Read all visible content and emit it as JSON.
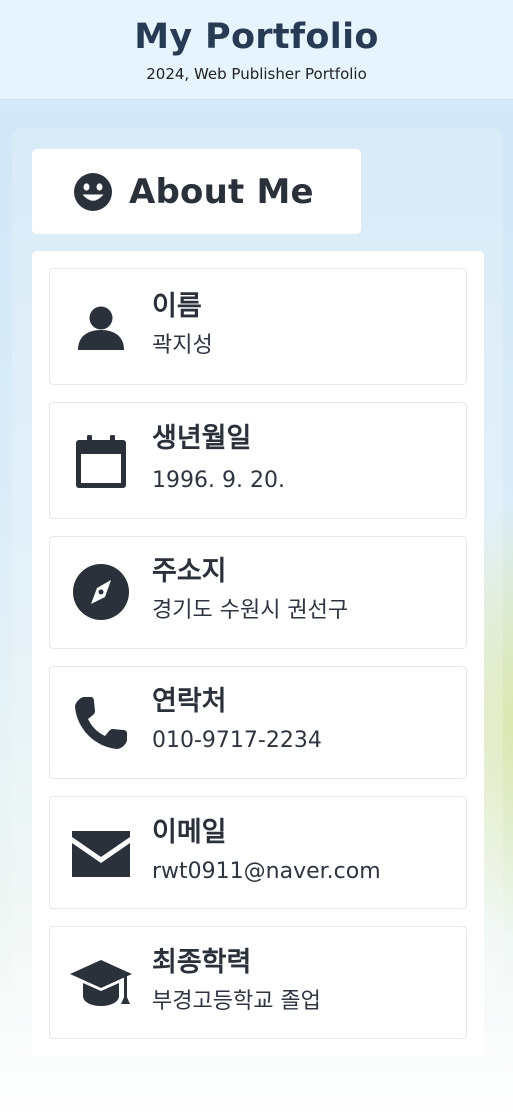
{
  "header": {
    "title": "My Portfolio",
    "subtitle": "2024, Web Publisher Portfolio"
  },
  "section": {
    "title": "About Me",
    "icon": "smile-icon"
  },
  "items": [
    {
      "icon": "person-icon",
      "label": "이름",
      "value": "곽지성"
    },
    {
      "icon": "calendar-icon",
      "label": "생년월일",
      "value": "1996. 9. 20."
    },
    {
      "icon": "compass-icon",
      "label": "주소지",
      "value": "경기도 수원시 권선구"
    },
    {
      "icon": "phone-icon",
      "label": "연락처",
      "value": "010-9717-2234"
    },
    {
      "icon": "envelope-icon",
      "label": "이메일",
      "value": "rwt0911@naver.com"
    },
    {
      "icon": "graduation-cap-icon",
      "label": "최종학력",
      "value": "부경고등학교 졸업"
    }
  ],
  "colors": {
    "text": "#2b313b",
    "heading": "#283b55",
    "header_bg": "#e6f4fd",
    "card_bg": "#ffffff"
  }
}
